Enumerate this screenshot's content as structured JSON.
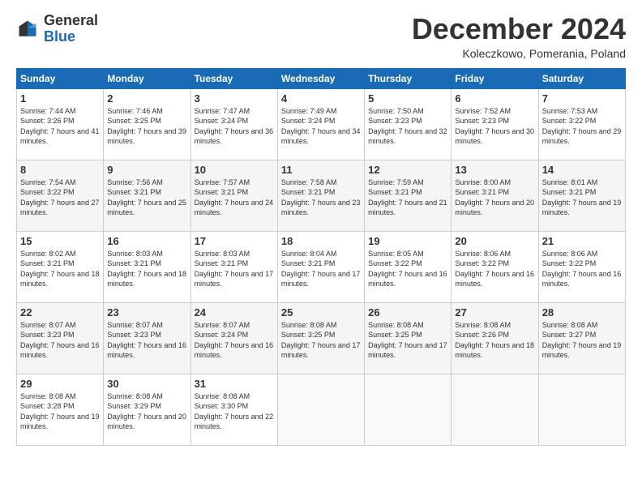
{
  "logo": {
    "text_general": "General",
    "text_blue": "Blue"
  },
  "header": {
    "month_title": "December 2024",
    "subtitle": "Koleczkowo, Pomerania, Poland"
  },
  "days_of_week": [
    "Sunday",
    "Monday",
    "Tuesday",
    "Wednesday",
    "Thursday",
    "Friday",
    "Saturday"
  ],
  "weeks": [
    [
      {
        "day": "1",
        "sunrise": "Sunrise: 7:44 AM",
        "sunset": "Sunset: 3:26 PM",
        "daylight": "Daylight: 7 hours and 41 minutes."
      },
      {
        "day": "2",
        "sunrise": "Sunrise: 7:46 AM",
        "sunset": "Sunset: 3:25 PM",
        "daylight": "Daylight: 7 hours and 39 minutes."
      },
      {
        "day": "3",
        "sunrise": "Sunrise: 7:47 AM",
        "sunset": "Sunset: 3:24 PM",
        "daylight": "Daylight: 7 hours and 36 minutes."
      },
      {
        "day": "4",
        "sunrise": "Sunrise: 7:49 AM",
        "sunset": "Sunset: 3:24 PM",
        "daylight": "Daylight: 7 hours and 34 minutes."
      },
      {
        "day": "5",
        "sunrise": "Sunrise: 7:50 AM",
        "sunset": "Sunset: 3:23 PM",
        "daylight": "Daylight: 7 hours and 32 minutes."
      },
      {
        "day": "6",
        "sunrise": "Sunrise: 7:52 AM",
        "sunset": "Sunset: 3:23 PM",
        "daylight": "Daylight: 7 hours and 30 minutes."
      },
      {
        "day": "7",
        "sunrise": "Sunrise: 7:53 AM",
        "sunset": "Sunset: 3:22 PM",
        "daylight": "Daylight: 7 hours and 29 minutes."
      }
    ],
    [
      {
        "day": "8",
        "sunrise": "Sunrise: 7:54 AM",
        "sunset": "Sunset: 3:22 PM",
        "daylight": "Daylight: 7 hours and 27 minutes."
      },
      {
        "day": "9",
        "sunrise": "Sunrise: 7:56 AM",
        "sunset": "Sunset: 3:21 PM",
        "daylight": "Daylight: 7 hours and 25 minutes."
      },
      {
        "day": "10",
        "sunrise": "Sunrise: 7:57 AM",
        "sunset": "Sunset: 3:21 PM",
        "daylight": "Daylight: 7 hours and 24 minutes."
      },
      {
        "day": "11",
        "sunrise": "Sunrise: 7:58 AM",
        "sunset": "Sunset: 3:21 PM",
        "daylight": "Daylight: 7 hours and 23 minutes."
      },
      {
        "day": "12",
        "sunrise": "Sunrise: 7:59 AM",
        "sunset": "Sunset: 3:21 PM",
        "daylight": "Daylight: 7 hours and 21 minutes."
      },
      {
        "day": "13",
        "sunrise": "Sunrise: 8:00 AM",
        "sunset": "Sunset: 3:21 PM",
        "daylight": "Daylight: 7 hours and 20 minutes."
      },
      {
        "day": "14",
        "sunrise": "Sunrise: 8:01 AM",
        "sunset": "Sunset: 3:21 PM",
        "daylight": "Daylight: 7 hours and 19 minutes."
      }
    ],
    [
      {
        "day": "15",
        "sunrise": "Sunrise: 8:02 AM",
        "sunset": "Sunset: 3:21 PM",
        "daylight": "Daylight: 7 hours and 18 minutes."
      },
      {
        "day": "16",
        "sunrise": "Sunrise: 8:03 AM",
        "sunset": "Sunset: 3:21 PM",
        "daylight": "Daylight: 7 hours and 18 minutes."
      },
      {
        "day": "17",
        "sunrise": "Sunrise: 8:03 AM",
        "sunset": "Sunset: 3:21 PM",
        "daylight": "Daylight: 7 hours and 17 minutes."
      },
      {
        "day": "18",
        "sunrise": "Sunrise: 8:04 AM",
        "sunset": "Sunset: 3:21 PM",
        "daylight": "Daylight: 7 hours and 17 minutes."
      },
      {
        "day": "19",
        "sunrise": "Sunrise: 8:05 AM",
        "sunset": "Sunset: 3:22 PM",
        "daylight": "Daylight: 7 hours and 16 minutes."
      },
      {
        "day": "20",
        "sunrise": "Sunrise: 8:06 AM",
        "sunset": "Sunset: 3:22 PM",
        "daylight": "Daylight: 7 hours and 16 minutes."
      },
      {
        "day": "21",
        "sunrise": "Sunrise: 8:06 AM",
        "sunset": "Sunset: 3:22 PM",
        "daylight": "Daylight: 7 hours and 16 minutes."
      }
    ],
    [
      {
        "day": "22",
        "sunrise": "Sunrise: 8:07 AM",
        "sunset": "Sunset: 3:23 PM",
        "daylight": "Daylight: 7 hours and 16 minutes."
      },
      {
        "day": "23",
        "sunrise": "Sunrise: 8:07 AM",
        "sunset": "Sunset: 3:23 PM",
        "daylight": "Daylight: 7 hours and 16 minutes."
      },
      {
        "day": "24",
        "sunrise": "Sunrise: 8:07 AM",
        "sunset": "Sunset: 3:24 PM",
        "daylight": "Daylight: 7 hours and 16 minutes."
      },
      {
        "day": "25",
        "sunrise": "Sunrise: 8:08 AM",
        "sunset": "Sunset: 3:25 PM",
        "daylight": "Daylight: 7 hours and 17 minutes."
      },
      {
        "day": "26",
        "sunrise": "Sunrise: 8:08 AM",
        "sunset": "Sunset: 3:25 PM",
        "daylight": "Daylight: 7 hours and 17 minutes."
      },
      {
        "day": "27",
        "sunrise": "Sunrise: 8:08 AM",
        "sunset": "Sunset: 3:26 PM",
        "daylight": "Daylight: 7 hours and 18 minutes."
      },
      {
        "day": "28",
        "sunrise": "Sunrise: 8:08 AM",
        "sunset": "Sunset: 3:27 PM",
        "daylight": "Daylight: 7 hours and 19 minutes."
      }
    ],
    [
      {
        "day": "29",
        "sunrise": "Sunrise: 8:08 AM",
        "sunset": "Sunset: 3:28 PM",
        "daylight": "Daylight: 7 hours and 19 minutes."
      },
      {
        "day": "30",
        "sunrise": "Sunrise: 8:08 AM",
        "sunset": "Sunset: 3:29 PM",
        "daylight": "Daylight: 7 hours and 20 minutes."
      },
      {
        "day": "31",
        "sunrise": "Sunrise: 8:08 AM",
        "sunset": "Sunset: 3:30 PM",
        "daylight": "Daylight: 7 hours and 22 minutes."
      },
      null,
      null,
      null,
      null
    ]
  ]
}
